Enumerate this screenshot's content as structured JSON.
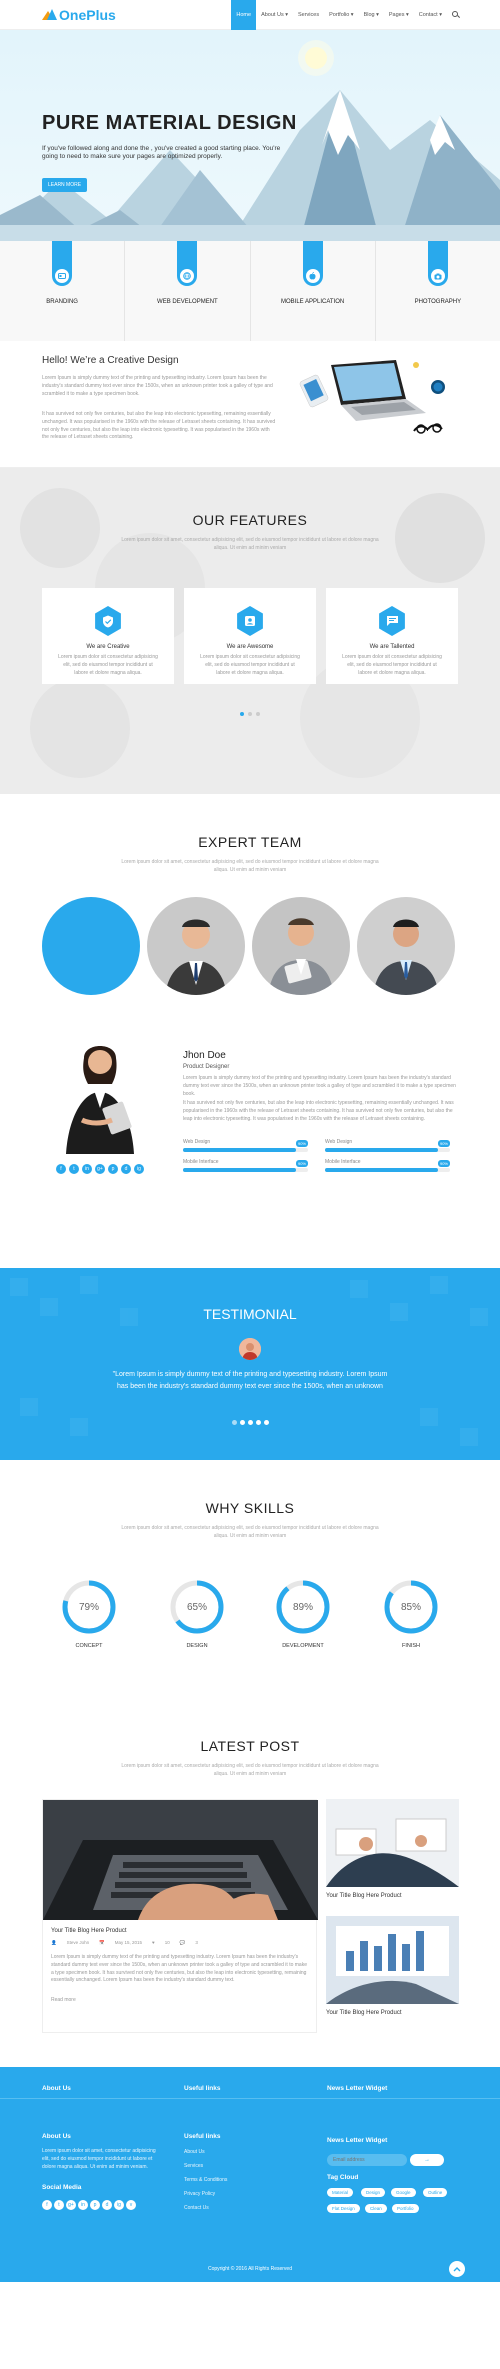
{
  "brand": {
    "name": "OnePlus",
    "accent": "#29a9ec"
  },
  "nav": {
    "items": [
      "Home",
      "About Us ▾",
      "Services",
      "Portfolio ▾",
      "Blog ▾",
      "Pages ▾",
      "Contact ▾"
    ],
    "active": "Home",
    "search_icon": "search-icon"
  },
  "hero": {
    "title": "PURE MATERIAL DESIGN",
    "text": "If you've followed along and done the , you've created a good starting place. You're going to need to make sure your pages are optimized properly.",
    "button": "LEARN MORE"
  },
  "services": [
    {
      "label": "BRANDING",
      "icon": "id-card-icon"
    },
    {
      "label": "WEB DEVELOPMENT",
      "icon": "globe-icon"
    },
    {
      "label": "MOBILE APPLICATION",
      "icon": "apple-icon"
    },
    {
      "label": "PHOTOGRAPHY",
      "icon": "camera-icon"
    }
  ],
  "hello": {
    "title": "Hello! We’re a Creative Design",
    "p1": "Lorem Ipsum is simply dummy text of the printing and typesetting industry. Lorem Ipsum has been the industry's standard dummy text ever since the 1500s, when an unknown printer took a galley of type and scrambled it to make a type specimen book.",
    "p2": "It has survived not only five centuries, but also the leap into electronic typesetting, remaining essentially unchanged. It was popularised in the 1960s with the release of Letraset sheets containing. It has survived not only five centuries, but also the leap into electronic typesetting. It was popularised in the 1960s with the release of Letraset sheets containing."
  },
  "features": {
    "title": "OUR FEATURES",
    "subtitle": "Lorem ipsum dolor sit amet, consectetur adipisicing elit, sed do eiusmod tempor incididunt ut labore et dolore magna aliqua. Ut enim ad minim veniam",
    "cards": [
      {
        "title": "We are Creative",
        "icon": "shield-icon",
        "text": "Lorem ipsum dolor sit consectetur adipisicing elit, sed do eiusmod tempor incididunt ut labore et dolore magna aliqua."
      },
      {
        "title": "We are Awesome",
        "icon": "contact-card-icon",
        "text": "Lorem ipsum dolor sit consectetur adipisicing elit, sed do eiusmod tempor incididunt ut labore et dolore magna aliqua."
      },
      {
        "title": "We are Tallented",
        "icon": "chat-icon",
        "text": "Lorem ipsum dolor sit consectetur adipisicing elit, sed do eiusmod tempor incididunt ut labore et dolore magna aliqua."
      }
    ]
  },
  "team": {
    "title": "EXPERT TEAM",
    "subtitle": "Lorem ipsum dolor sit amet, consectetur adipisicing elit, sed do eiusmod tempor incididunt ut labore et dolore magna aliqua. Ut enim ad minim veniam",
    "name": "Jhon Doe",
    "role": "Product Designer",
    "text1": "Lorem Ipsum is simply dummy text of the printing and typesetting industry. Lorem Ipsum has been the industry's standard dummy text ever since the 1500s, when an unknown printer took a galley of type and scrambled it to make a type specimen book.",
    "text2": "It has survived not only five centuries, but also the leap into electronic typesetting, remaining essentially unchanged. It was popularised in the 1960s with the release of Letraset sheets containing. It has survived not only five centuries, but also the leap into electronic typesetting. It was popularised in the 1960s with the release of Letraset sheets containing.",
    "skills": [
      {
        "label": "Web Design",
        "value": "90%",
        "fraction": 0.9
      },
      {
        "label": "Web Design",
        "value": "90%",
        "fraction": 0.9
      },
      {
        "label": "Mobile Interface",
        "value": "90%",
        "fraction": 0.9
      },
      {
        "label": "Mobile Interface",
        "value": "90%",
        "fraction": 0.9
      }
    ],
    "social_icons": [
      "facebook-icon",
      "twitter-icon",
      "linkedin-icon",
      "google-plus-icon",
      "pinterest-icon",
      "dribbble-icon",
      "instagram-icon"
    ],
    "social_glyphs": [
      "f",
      "t",
      "in",
      "g+",
      "p",
      "d",
      "ig"
    ]
  },
  "testimonial": {
    "title": "TESTIMONIAL",
    "text": "\"Lorem Ipsum is simply dummy text of the printing and typesetting industry. Lorem Ipsum has been the industry's standard dummy text ever since the 1500s, when an unknown"
  },
  "skills": {
    "title": "WHY SKILLS",
    "subtitle": "Lorem ipsum dolor sit amet, consectetur adipisicing elit, sed do eiusmod tempor incididunt ut labore et dolore magna aliqua. Ut enim ad minim veniam",
    "items": [
      {
        "label": "CONCEPT",
        "value": "79%",
        "fraction": 0.79
      },
      {
        "label": "DESIGN",
        "value": "65%",
        "fraction": 0.65
      },
      {
        "label": "DEVELOPMENT",
        "value": "89%",
        "fraction": 0.89
      },
      {
        "label": "FINISH",
        "value": "85%",
        "fraction": 0.85
      }
    ]
  },
  "posts": {
    "title": "LATEST POST",
    "subtitle": "Lorem ipsum dolor sit amet, consectetur adipisicing elit, sed do eiusmod tempor incididunt ut labore et dolore magna aliqua. Ut enim ad minim veniam",
    "main": {
      "title": "Your Title Blog Here Product",
      "author": "Steve John",
      "date": "May 15, 2015",
      "likes": "10",
      "comments": "3",
      "text": "Lorem Ipsum is simply dummy text of the printing and typesetting industry. Lorem Ipsum has been the industry's standard dummy text ever since the 1500s, when an unknown printer took a galley of type and scrambled it to make a type specimen book. It has survived not only five centuries, but also the leap into electronic typesetting, remaining essentially unchanged. Lorem Ipsum has been the industry's standard dummy text.",
      "more": "Read more"
    },
    "side": [
      {
        "title": "Your Title Blog Here Product"
      },
      {
        "title": "Your Title Blog Here Product"
      }
    ]
  },
  "footer": {
    "top_headings": [
      "About Us",
      "Useful links",
      "News Letter Widget"
    ],
    "about_title": "About Us",
    "about_text": "Lorem ipsum dolor sit amet, consectetur adipisicing elit, sed do eiusmod tempor incididunt ut labore et dolore magna aliqua. Ut enim ad minim veniam.",
    "social_title": "Social Media",
    "links_title": "Useful links",
    "links": [
      "About Us",
      "Services",
      "Terms & Conditions",
      "Privacy Policy",
      "Contact Us"
    ],
    "newsletter_title": "News Letter Widget",
    "newsletter_placeholder": "Email address",
    "newsletter_button": "→",
    "tags_title": "Tag Cloud",
    "tags": [
      "Material",
      "Design",
      "Google",
      "Outline",
      "Flat Design",
      "Clean",
      "Portfolio"
    ],
    "social_icons": [
      "facebook-icon",
      "twitter-icon",
      "google-plus-icon",
      "linkedin-icon",
      "pinterest-icon",
      "dribbble-icon",
      "instagram-icon",
      "vimeo-icon"
    ],
    "social_glyphs": [
      "f",
      "t",
      "g+",
      "in",
      "p",
      "d",
      "ig",
      "v"
    ],
    "copyright": "Copyright © 2016 All Rights Reserved"
  }
}
